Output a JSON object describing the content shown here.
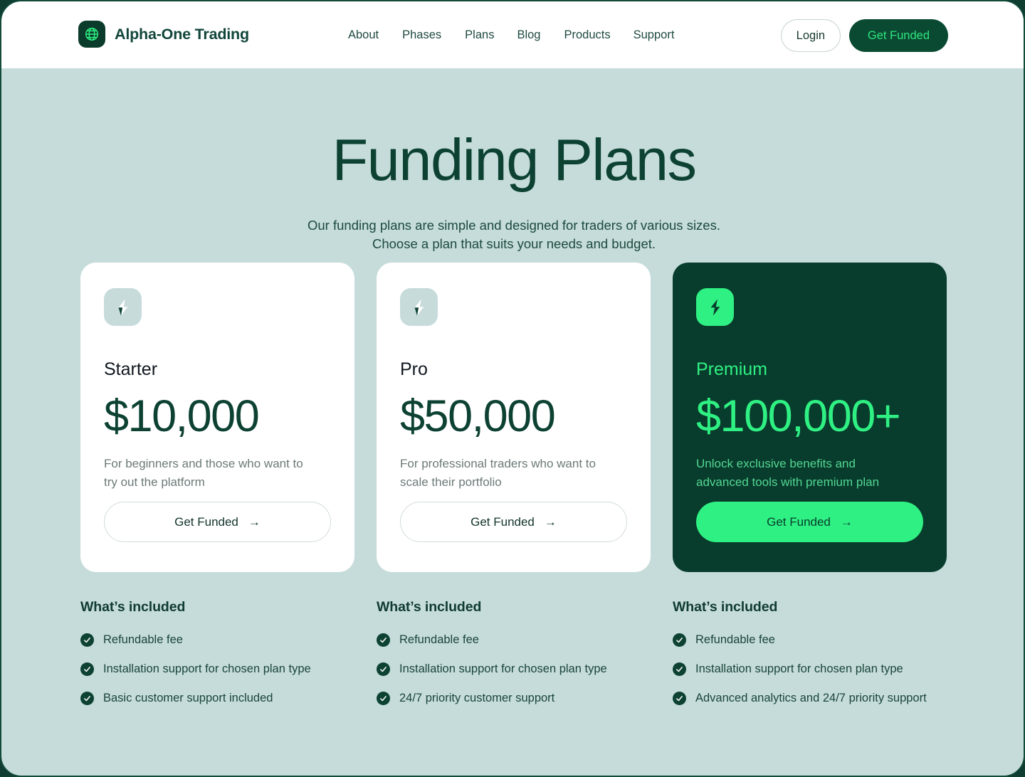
{
  "brand": {
    "name": "Alpha-One Trading",
    "logo_icon": "globe-icon",
    "logo_bg": "#0b3b2b",
    "logo_fg": "#2ff183"
  },
  "nav": {
    "items": [
      {
        "label": "About"
      },
      {
        "label": "Phases"
      },
      {
        "label": "Plans"
      },
      {
        "label": "Blog"
      },
      {
        "label": "Products"
      },
      {
        "label": "Support"
      }
    ]
  },
  "header_actions": {
    "login_label": "Login",
    "get_funded_label": "Get Funded",
    "get_funded_bg": "#0b4a32",
    "get_funded_fg": "#2de57f"
  },
  "hero": {
    "title": "Funding Plans",
    "subtitle_line1": "Our funding plans are simple and designed for traders of various sizes.",
    "subtitle_line2": "Choose a plan that suits your needs and budget."
  },
  "plans": [
    {
      "name": "Starter",
      "price": "$10,000",
      "description_line1": "For beginners and those who want to",
      "description_line2": "try out the platform",
      "cta_label": "Get Funded",
      "cta_arrow": "→",
      "icon": "lightning-bolt-icon",
      "featured": false
    },
    {
      "name": "Pro",
      "price": "$50,000",
      "description_line1": "For professional traders who want to",
      "description_line2": "scale their portfolio",
      "cta_label": "Get Funded",
      "cta_arrow": "→",
      "icon": "lightning-bolt-icon",
      "featured": false
    },
    {
      "name": "Premium",
      "price": "$100,000+",
      "description_line1": "Unlock exclusive benefits and",
      "description_line2": "advanced tools with premium plan",
      "cta_label": "Get Funded",
      "cta_arrow": "→",
      "icon": "lightning-bolt-icon",
      "featured": true
    }
  ],
  "included": [
    {
      "title": "What’s included",
      "features": [
        "Refundable fee",
        "Installation support for chosen plan type",
        "Basic customer support included"
      ]
    },
    {
      "title": "What’s included",
      "features": [
        "Refundable fee",
        "Installation support for chosen plan type",
        "24/7 priority customer support"
      ]
    },
    {
      "title": "What’s included",
      "features": [
        "Refundable fee",
        "Installation support for chosen plan type",
        "Advanced analytics and 24/7 priority support"
      ]
    }
  ],
  "theme": {
    "page_bg": "#c5dcda",
    "frame_border": "#134b3b",
    "dark_green": "#0d4233",
    "bright_green": "#2ff183",
    "card_dark_bg": "#083c2c"
  }
}
